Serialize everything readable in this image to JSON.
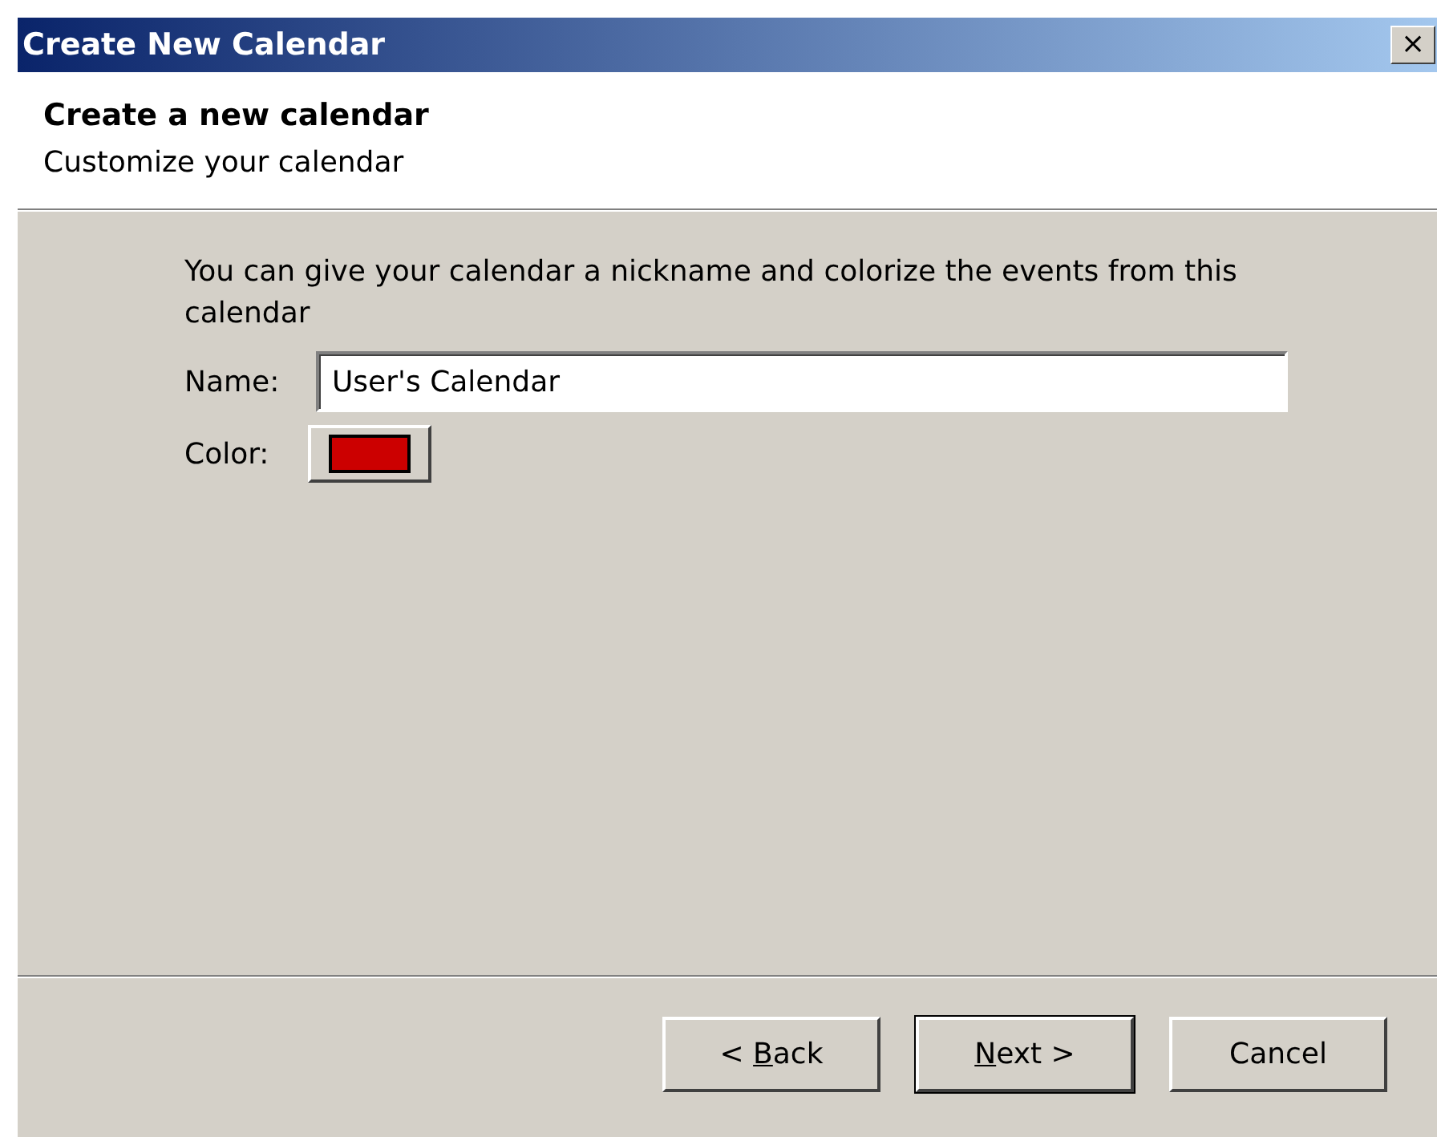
{
  "window": {
    "title": "Create New Calendar",
    "close": "×"
  },
  "header": {
    "title": "Create a new calendar",
    "subtitle": "Customize your calendar"
  },
  "intro": "You can give your calendar a nickname and colorize the events from this calendar",
  "name_field": {
    "label": "Name:",
    "value": "User's Calendar"
  },
  "color_field": {
    "label": "Color:",
    "color": "#cc0000"
  },
  "buttons": [
    {
      "before": "< ",
      "access_key": "B",
      "after": "ack",
      "default": false
    },
    {
      "access_key": "N",
      "after": "ext >",
      "default": true
    },
    {
      "before": "Cancel",
      "default": false
    }
  ]
}
